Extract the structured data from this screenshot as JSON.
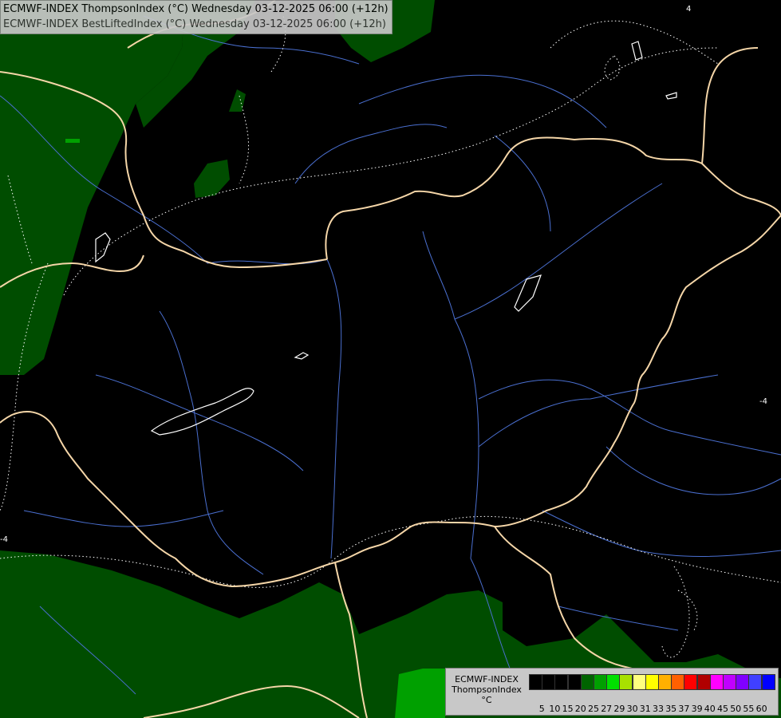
{
  "title": {
    "line1": "ECMWF-INDEX ThompsonIndex (°C) Wednesday 03-12-2025 06:00 (+12h)",
    "line2": "ECMWF-INDEX BestLiftedIndex (°C) Wednesday 03-12-2025 06:00 (+12h)"
  },
  "legend": {
    "line1": "ECMWF-INDEX",
    "line2": "ThompsonIndex",
    "line3": "°C",
    "colors": [
      "#000000",
      "#000000",
      "#000000",
      "#000000",
      "#006400",
      "#00a000",
      "#00e000",
      "#a8e000",
      "#ffff80",
      "#ffff00",
      "#ffb000",
      "#ff6000",
      "#ff0000",
      "#b00000",
      "#ff00ff",
      "#c000ff",
      "#8000ff",
      "#4040ff",
      "#0000ff"
    ],
    "ticks": [
      "5",
      "10",
      "15",
      "20",
      "25",
      "27",
      "29",
      "30",
      "31",
      "33",
      "35",
      "37",
      "39",
      "40",
      "45",
      "50",
      "55",
      "60"
    ]
  },
  "contour_labels": [
    "-4",
    "4",
    "-4"
  ],
  "colors": {
    "border": "#f5d6a8",
    "river": "#4a6fd0",
    "green_dark": "#004d00",
    "green_light": "#00a000"
  }
}
